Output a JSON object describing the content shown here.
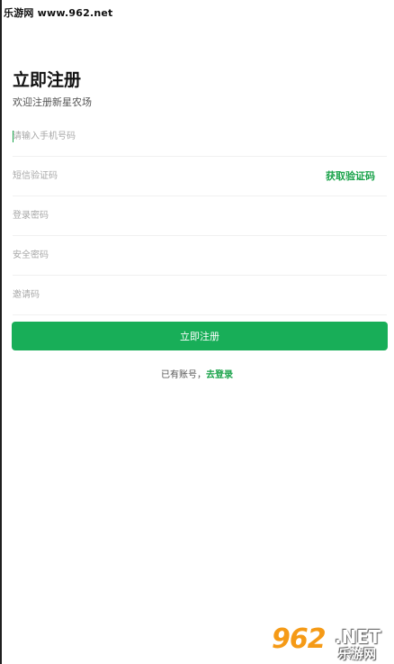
{
  "watermark": {
    "top_text": "乐游网 www.962.net",
    "logo_number": "962",
    "logo_domain": ".NET",
    "logo_sub": "乐游网"
  },
  "header": {
    "title": "立即注册",
    "subtitle": "欢迎注册新星农场"
  },
  "form": {
    "phone": {
      "placeholder": "请输入手机号码",
      "value": ""
    },
    "sms_code": {
      "placeholder": "短信验证码",
      "value": "",
      "get_code_label": "获取验证码"
    },
    "login_password": {
      "placeholder": "登录密码",
      "value": ""
    },
    "security_password": {
      "placeholder": "安全密码",
      "value": ""
    },
    "invite_code": {
      "placeholder": "邀请码",
      "value": ""
    },
    "submit_label": "立即注册"
  },
  "footer": {
    "has_account_text": "已有账号，",
    "login_link": "去登录"
  },
  "colors": {
    "accent": "#18ae58",
    "link": "#1aa34a"
  }
}
